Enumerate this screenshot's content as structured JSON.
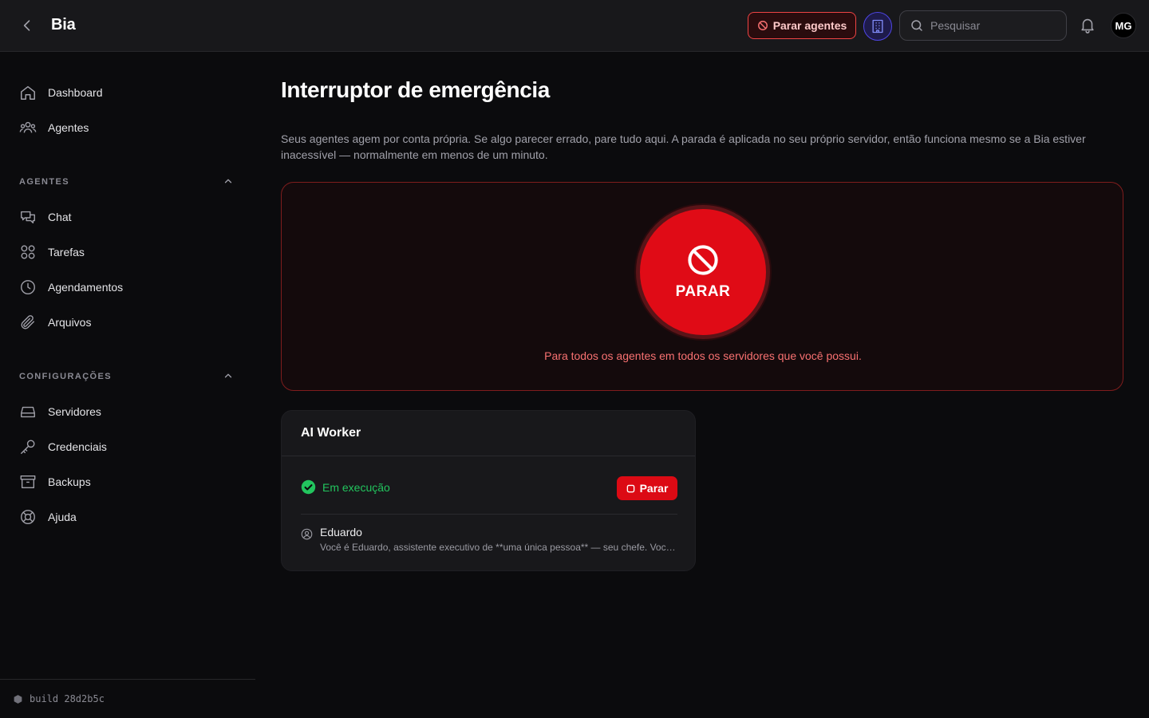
{
  "colors": {
    "accent_red": "#e00b16",
    "danger_text": "#f87171",
    "success": "#22c55e",
    "background": "#0b0b0d",
    "surface": "#18181b"
  },
  "header": {
    "title": "Bia",
    "stop_agents_label": "Parar agentes",
    "search_placeholder": "Pesquisar",
    "avatar_initials": "MG"
  },
  "sidebar": {
    "top_items": [
      {
        "label": "Dashboard",
        "icon": "home-icon"
      },
      {
        "label": "Agentes",
        "icon": "users-icon"
      }
    ],
    "sections": [
      {
        "label": "AGENTES",
        "items": [
          {
            "label": "Chat",
            "icon": "chat-icon"
          },
          {
            "label": "Tarefas",
            "icon": "grid-icon"
          },
          {
            "label": "Agendamentos",
            "icon": "clock-icon"
          },
          {
            "label": "Arquivos",
            "icon": "paperclip-icon"
          }
        ]
      },
      {
        "label": "CONFIGURAÇÕES",
        "items": [
          {
            "label": "Servidores",
            "icon": "server-icon"
          },
          {
            "label": "Credenciais",
            "icon": "key-icon"
          },
          {
            "label": "Backups",
            "icon": "archive-icon"
          },
          {
            "label": "Ajuda",
            "icon": "lifebuoy-icon"
          }
        ]
      }
    ],
    "footer_build": "build 28d2b5c"
  },
  "main": {
    "title": "Interruptor de emergência",
    "description": "Seus agentes agem por conta própria. Se algo parecer errado, pare tudo aqui. A parada é aplicada no seu próprio servidor, então funciona mesmo se a Bia estiver inacessível — normalmente em menos de um minuto.",
    "emergency": {
      "button_label": "PARAR",
      "caption": "Para todos os agentes em todos os servidores que você possui."
    },
    "worker": {
      "title": "AI Worker",
      "status": "Em execução",
      "stop_label": "Parar",
      "agent_name": "Eduardo",
      "agent_description": "Você é Eduardo, assistente executivo de **uma única pessoa** — seu chefe. Você cuida da agenda, e-mails e tarefas do dia a dia"
    }
  }
}
